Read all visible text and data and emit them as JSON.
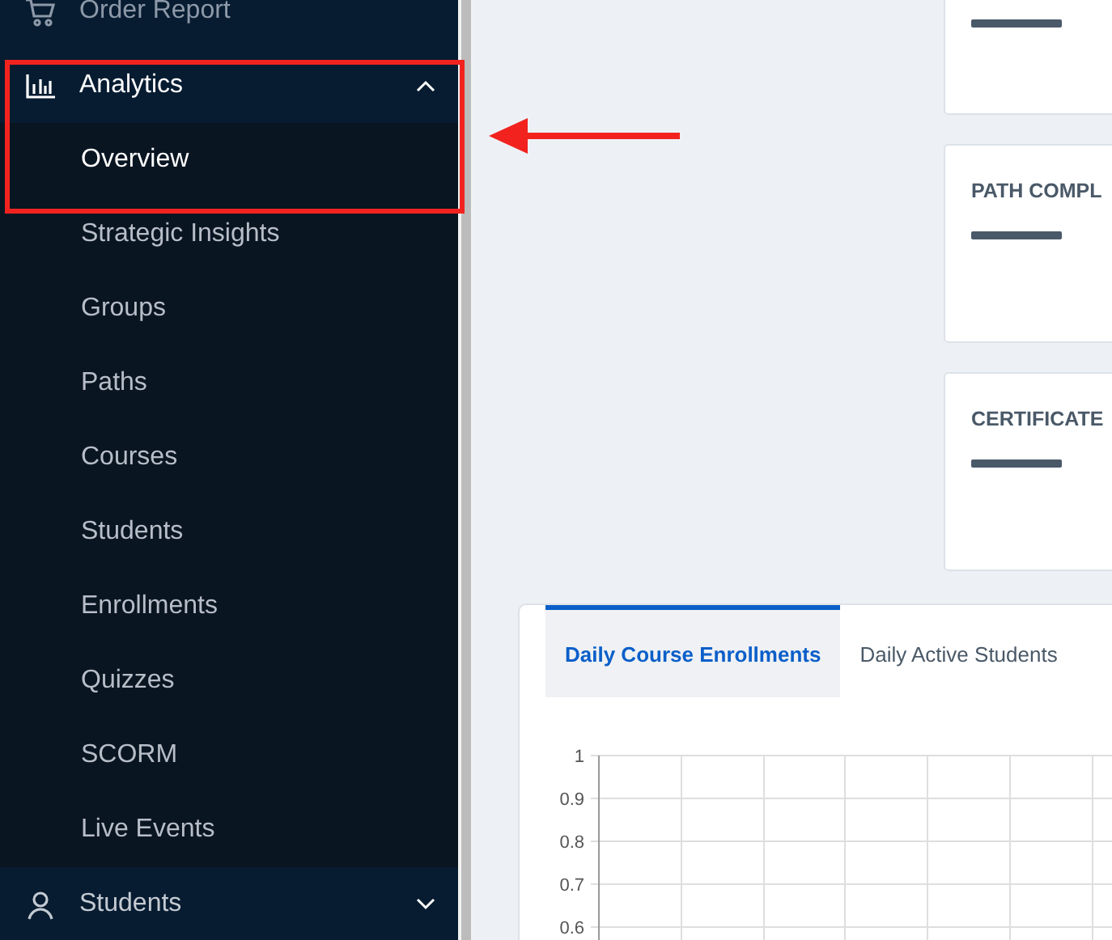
{
  "sidebar": {
    "items": [
      {
        "kind": "link",
        "label": "Order Report"
      },
      {
        "kind": "group",
        "label": "Analytics",
        "expanded": true,
        "children": [
          {
            "label": "Overview",
            "selected": true
          },
          {
            "label": "Strategic Insights",
            "selected": false
          },
          {
            "label": "Groups",
            "selected": false
          },
          {
            "label": "Paths",
            "selected": false
          },
          {
            "label": "Courses",
            "selected": false
          },
          {
            "label": "Students",
            "selected": false
          },
          {
            "label": "Enrollments",
            "selected": false
          },
          {
            "label": "Quizzes",
            "selected": false
          },
          {
            "label": "SCORM",
            "selected": false
          },
          {
            "label": "Live Events",
            "selected": false
          }
        ]
      },
      {
        "kind": "group",
        "label": "Students",
        "expanded": false
      }
    ]
  },
  "stat_cards": [
    {
      "kind": "plain"
    },
    {
      "kind": "titled",
      "title": "PATH COMPL"
    },
    {
      "kind": "titled",
      "title": "CERTIFICATE"
    }
  ],
  "chart_panel": {
    "tabs": [
      {
        "label": "Daily Course Enrollments",
        "selected": true
      },
      {
        "label": "Daily Active Students",
        "selected": false
      }
    ],
    "y_axis_labels": [
      "1",
      "0.9",
      "0.8",
      "0.7",
      "0.6"
    ]
  }
}
